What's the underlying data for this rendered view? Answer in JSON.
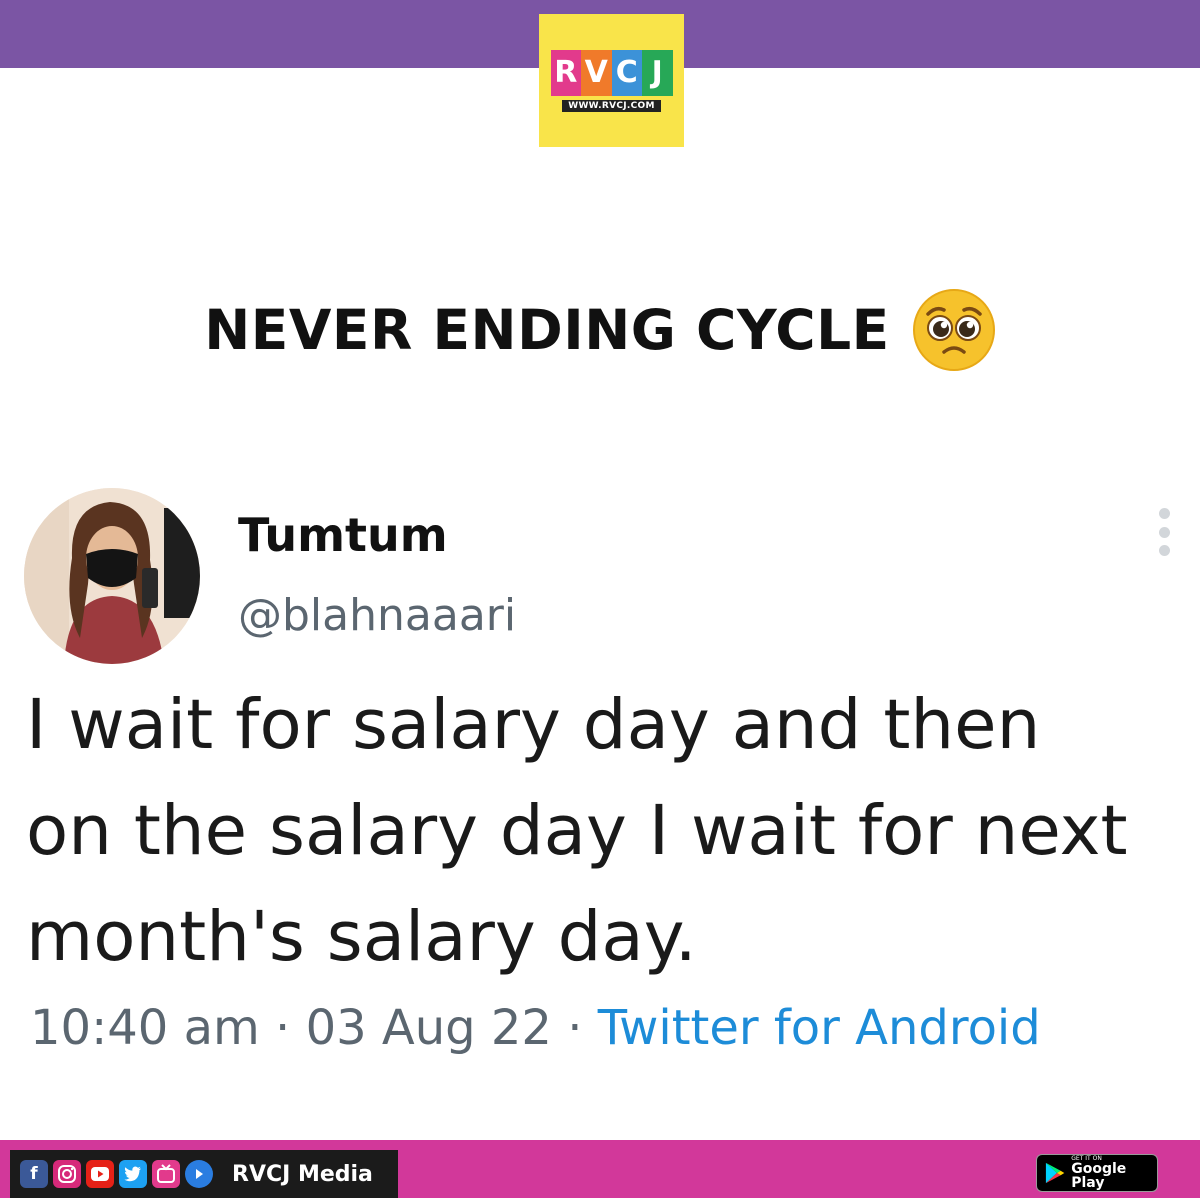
{
  "header": {
    "logo": {
      "text": "RVCJ",
      "letters": [
        "R",
        "V",
        "C",
        "J"
      ],
      "url": "WWW.RVCJ.COM"
    }
  },
  "headline": {
    "text": "NEVER ENDING CYCLE",
    "emoji": "pleading-face-icon"
  },
  "tweet": {
    "author_name": "Tumtum",
    "handle": "@blahnaaari",
    "body_lines": [
      "I wait for salary day and then",
      "on the salary day I wait for next",
      "month's salary day."
    ],
    "time": "10:40 am",
    "date": "03 Aug 22",
    "separator": "·",
    "source": "Twitter for Android"
  },
  "footer": {
    "social_icons": [
      "facebook-icon",
      "instagram-icon",
      "youtube-icon",
      "twitter-icon",
      "ig-tv-icon",
      "play-arrow-icon"
    ],
    "brand": "RVCJ Media",
    "store_badge": {
      "small": "GET IT ON",
      "big": "Google Play"
    }
  },
  "colors": {
    "top_band": "#7b55a4",
    "bottom_band": "#d2389a",
    "logo_bg": "#f9e44a",
    "logo_letters": [
      "#e23a8c",
      "#f07a2a",
      "#3c92d8",
      "#27a857"
    ],
    "link": "#1d8cd8",
    "meta": "#5b6670"
  }
}
